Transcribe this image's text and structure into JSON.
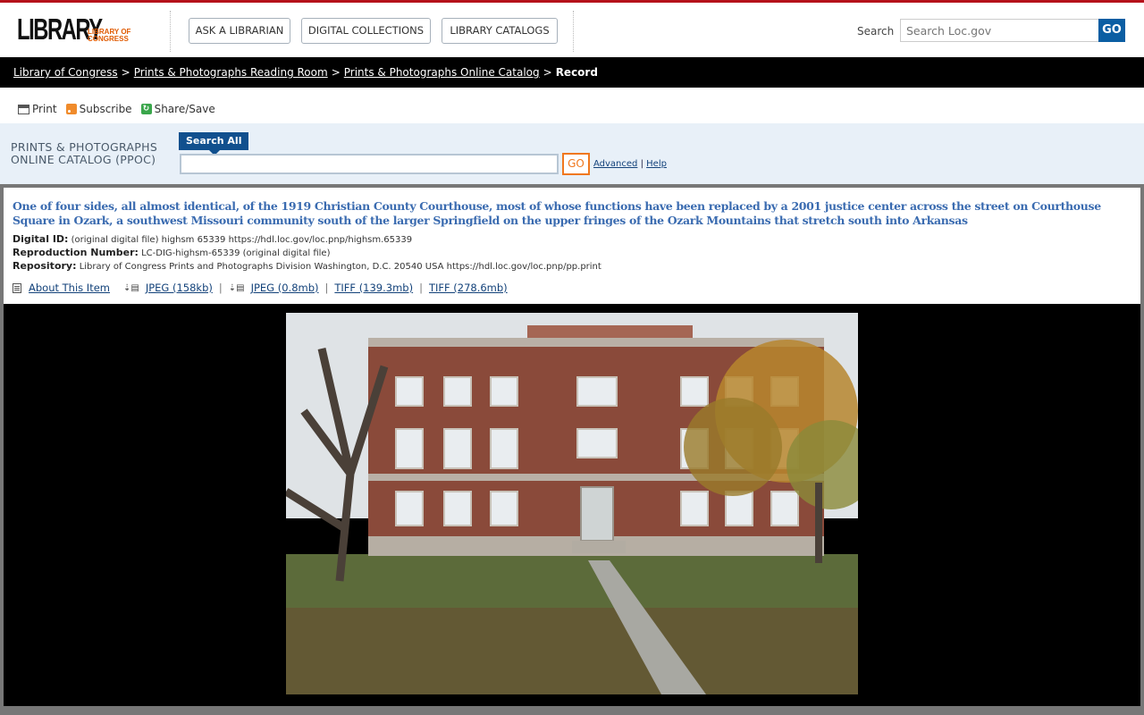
{
  "header": {
    "logo_text": "LIBRARY",
    "logo_sub": "LIBRARY OF CONGRESS",
    "nav": [
      "ASK A LIBRARIAN",
      "DIGITAL COLLECTIONS",
      "LIBRARY CATALOGS"
    ],
    "search_label": "Search",
    "search_placeholder": "Search Loc.gov",
    "search_go": "GO"
  },
  "breadcrumb": {
    "items": [
      "Library of Congress",
      "Prints & Photographs Reading Room",
      "Prints & Photographs Online Catalog"
    ],
    "current": "Record",
    "separator": ">"
  },
  "tools": {
    "print": "Print",
    "subscribe": "Subscribe",
    "share": "Share/Save"
  },
  "ppoc": {
    "title_line1": "PRINTS & PHOTOGRAPHS",
    "title_line2": "ONLINE CATALOG (PPOC)",
    "search_tab": "Search All",
    "go": "GO",
    "advanced": "Advanced",
    "help": "Help"
  },
  "record": {
    "title": "One of four sides, all almost identical, of the 1919 Christian County Courthouse, most of whose functions have been replaced by a 2001 justice center across the street on Courthouse Square in Ozark, a southwest Missouri community south of the larger Springfield on the upper fringes of the Ozark Mountains that stretch south into Arkansas",
    "digital_id_label": "Digital ID:",
    "digital_id_value": "(original digital file) highsm 65339 https://hdl.loc.gov/loc.pnp/highsm.65339",
    "repro_label": "Reproduction Number:",
    "repro_value": "LC-DIG-highsm-65339 (original digital file)",
    "repository_label": "Repository:",
    "repository_value": "Library of Congress Prints and Photographs Division Washington, D.C. 20540 USA https://hdl.loc.gov/loc.pnp/pp.print",
    "about": "About This Item",
    "downloads": [
      "JPEG (158kb)",
      "JPEG (0.8mb)",
      "TIFF (139.3mb)",
      "TIFF (278.6mb)"
    ]
  },
  "colors": {
    "brand_red": "#b5121b",
    "nav_blue": "#0b5ea3",
    "title_blue": "#3a6bb0",
    "go_orange": "#f0781e"
  }
}
